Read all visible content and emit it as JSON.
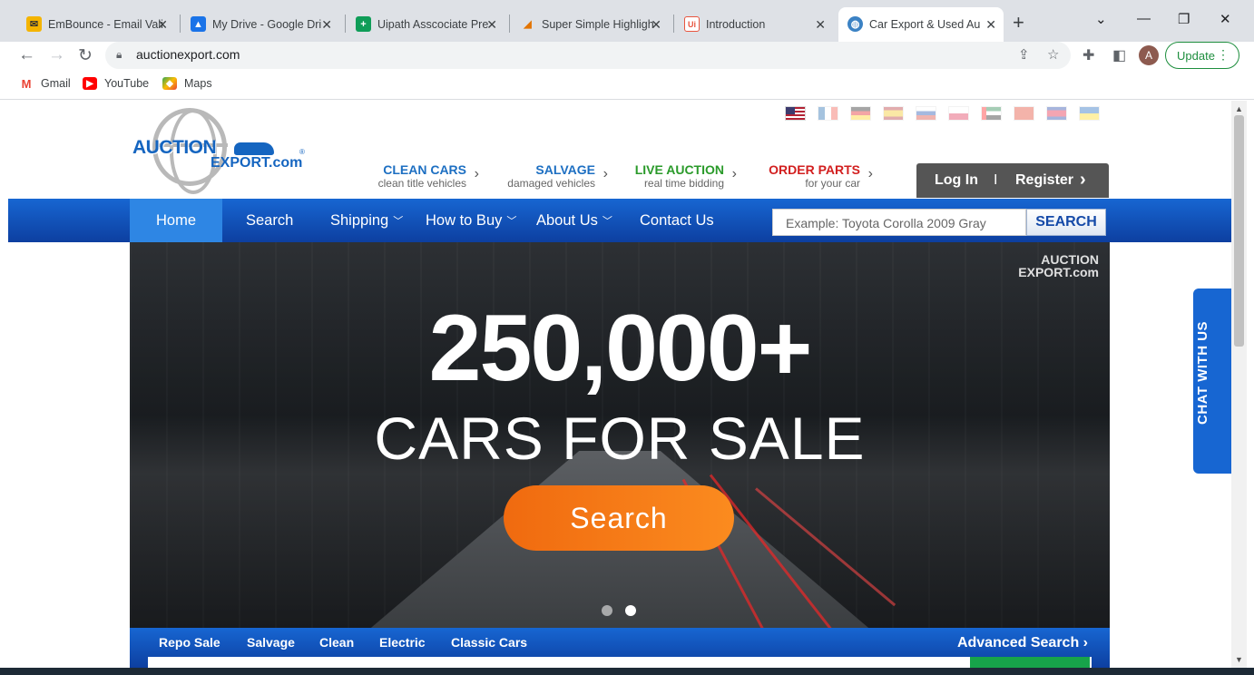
{
  "browser": {
    "tabs": [
      {
        "title": "EmBounce - Email Vali",
        "favicon": "envelope-icon",
        "color": "#f4b400"
      },
      {
        "title": "My Drive - Google Dri",
        "favicon": "drive-icon",
        "color": "#1a73e8"
      },
      {
        "title": "Uipath Asscociate Pre",
        "favicon": "sheets-icon",
        "color": "#0f9d58"
      },
      {
        "title": "Super Simple Highligh",
        "favicon": "highlighter-icon",
        "color": "#e37400"
      },
      {
        "title": "Introduction",
        "favicon": "uipath-icon",
        "color": "#e8553f"
      },
      {
        "title": "Car Export & Used Au",
        "favicon": "globe-icon",
        "color": "#3b82c4",
        "active": true
      }
    ],
    "url": "auctionexport.com",
    "update_label": "Update",
    "profile_initial": "A",
    "bookmarks": [
      {
        "label": "Gmail",
        "icon": "gmail-icon"
      },
      {
        "label": "YouTube",
        "icon": "youtube-icon"
      },
      {
        "label": "Maps",
        "icon": "maps-icon"
      }
    ]
  },
  "site": {
    "logo": {
      "line1": "AUCTION",
      "line2": "EXPORT.com",
      "reg": "®"
    },
    "flags": [
      "us",
      "fr",
      "de",
      "es",
      "ru",
      "pl",
      "ae",
      "cn",
      "kh",
      "ua"
    ],
    "categories": [
      {
        "title": "CLEAN CARS",
        "subtitle": "clean title vehicles",
        "color": "#1d6fc2"
      },
      {
        "title": "SALVAGE",
        "subtitle": "damaged vehicles",
        "color": "#1d6fc2"
      },
      {
        "title": "LIVE AUCTION",
        "subtitle": "real time bidding",
        "color": "#2a9a2a"
      },
      {
        "title": "ORDER PARTS",
        "subtitle": "for your car",
        "color": "#d21f1f"
      }
    ],
    "login": {
      "login_label": "Log In",
      "separator": "I",
      "register_label": "Register"
    },
    "nav": [
      "Home",
      "Search",
      "Shipping",
      "How to Buy",
      "About Us",
      "Contact Us"
    ],
    "search": {
      "placeholder": "Example: Toyota Corolla 2009 Gray",
      "button": "SEARCH"
    },
    "hero": {
      "headline": "250,000+",
      "subheadline": "CARS FOR SALE",
      "button": "Search",
      "watermark_line1": "AUCTION",
      "watermark_line2": "EXPORT.com",
      "active_slide": 2,
      "slide_count": 2
    },
    "category_tabs": [
      "Repo Sale",
      "Salvage",
      "Clean",
      "Electric",
      "Classic Cars"
    ],
    "advanced_search": "Advanced Search",
    "chat": "CHAT WITH US"
  }
}
